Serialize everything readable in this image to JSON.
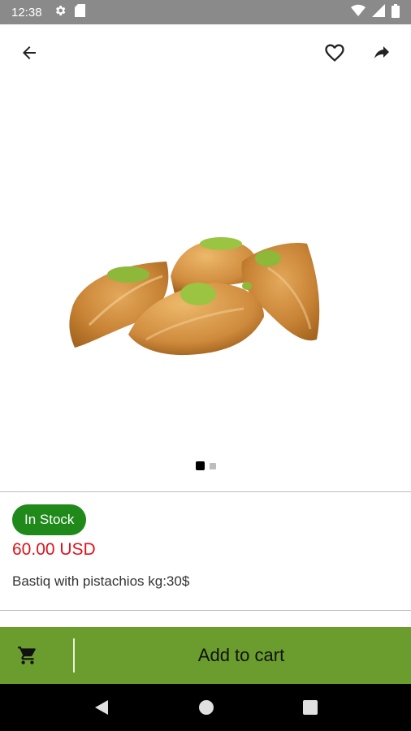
{
  "status_bar": {
    "time": "12:38",
    "icons": [
      "settings-icon",
      "sd-card-icon",
      "wifi-icon",
      "signal-icon",
      "battery-icon"
    ]
  },
  "app_bar": {
    "icons": [
      "back-arrow-icon",
      "heart-outline-icon",
      "share-icon"
    ]
  },
  "product": {
    "image_description": "baklava pastries with pistachio",
    "carousel": {
      "total": 2,
      "active_index": 0
    },
    "stock_label": "In Stock",
    "price": "60.00 USD",
    "description": "Bastiq with pistachios  kg:30$"
  },
  "cart": {
    "icon": "cart-icon",
    "label": "Add to cart"
  },
  "nav_bar": {
    "icons": [
      "nav-back-icon",
      "nav-home-icon",
      "nav-recents-icon"
    ]
  },
  "colors": {
    "status_bar": "#8a8a8a",
    "stock_badge": "#1f8a19",
    "price": "#e0121c",
    "cart_bar": "#6a9d2d",
    "nav_bar": "#000000"
  }
}
